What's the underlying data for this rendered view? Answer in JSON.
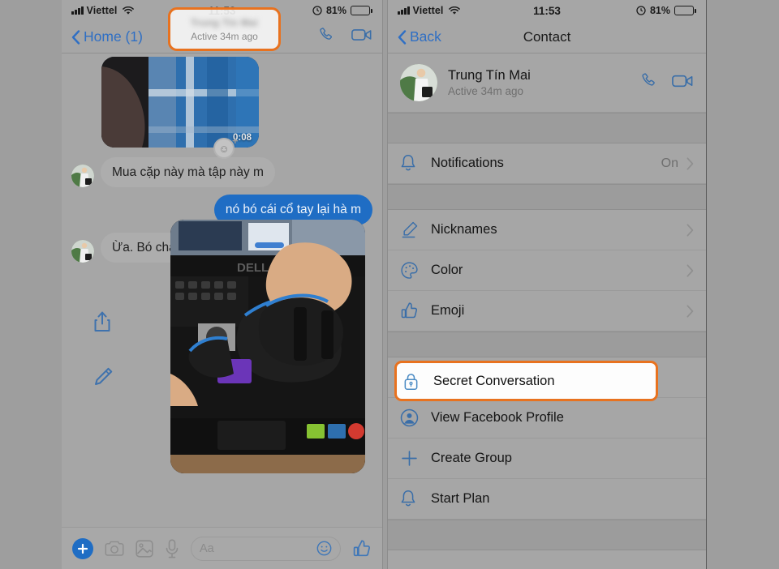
{
  "status_bar": {
    "carrier": "Viettel",
    "time": "11:53",
    "battery_percent": "81%"
  },
  "left_phone": {
    "nav": {
      "back_label": "Home (1)",
      "call_icon": "phone-icon",
      "video_icon": "video-camera-icon"
    },
    "header_chip": {
      "name_blurred": "Trung Tin Mai",
      "status": "Active 34m ago"
    },
    "thread": {
      "video_message": {
        "duration": "0:08",
        "reaction_icon": "emoji-plus-icon"
      },
      "messages": [
        {
          "side": "in",
          "text": "Mua cặp này mà tập này m"
        },
        {
          "side": "out",
          "text": "nó bó cái cổ tay lại hà m"
        },
        {
          "side": "in",
          "text": "Ừa. Bó chắc cổ tay"
        }
      ],
      "photo_actions": [
        "share-icon",
        "edit-pencil-icon"
      ]
    },
    "composer": {
      "plus": "+",
      "camera_icon": "camera-icon",
      "gallery_icon": "photo-gallery-icon",
      "mic_icon": "microphone-icon",
      "input_placeholder": "Aa",
      "smiley_icon": "smiley-face-icon",
      "thumb_icon": "thumbs-up-icon"
    }
  },
  "right_phone": {
    "nav": {
      "back_label": "Back",
      "title": "Contact"
    },
    "contact": {
      "name": "Trung Tín Mai",
      "status": "Active 34m ago",
      "call_icon": "phone-icon",
      "video_icon": "video-camera-icon"
    },
    "sections": [
      {
        "items": [
          {
            "icon": "bell-icon",
            "label": "Notifications",
            "value": "On",
            "chevron": true
          }
        ]
      },
      {
        "items": [
          {
            "icon": "pencil-icon",
            "label": "Nicknames",
            "value": "",
            "chevron": true
          },
          {
            "icon": "palette-icon",
            "label": "Color",
            "value": "",
            "chevron": true
          },
          {
            "icon": "thumbs-up-icon",
            "label": "Emoji",
            "value": "",
            "chevron": true
          }
        ]
      },
      {
        "items": [
          {
            "icon": "lock-icon",
            "label": "Secret Conversation",
            "value": "",
            "chevron": false,
            "highlighted": true
          },
          {
            "icon": "person-icon",
            "label": "View Facebook Profile",
            "value": "",
            "chevron": false
          },
          {
            "icon": "plus-icon",
            "label": "Create Group",
            "value": "",
            "chevron": false
          },
          {
            "icon": "bell-icon",
            "label": "Start Plan",
            "value": "",
            "chevron": false
          }
        ]
      }
    ]
  },
  "colors": {
    "accent_orange": "#e8721f",
    "ios_blue": "#2f6fc4",
    "bubble_out_blue": "#1f6dc4",
    "bubble_in_gray": "#adadad",
    "page_bg": "#9e9e9e"
  }
}
